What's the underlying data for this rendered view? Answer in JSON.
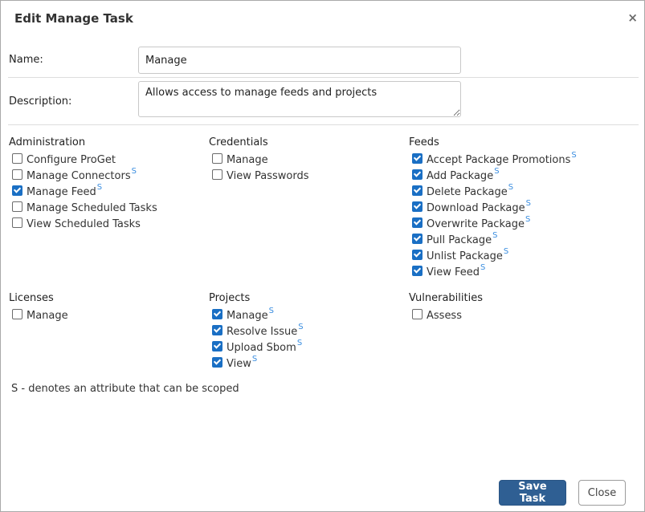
{
  "dialog": {
    "title": "Edit Manage Task",
    "close_icon": "×"
  },
  "form": {
    "name_label": "Name:",
    "name_value": "Manage",
    "description_label": "Description:",
    "description_value": "Allows access to manage feeds and projects"
  },
  "groups": [
    {
      "title": "Administration",
      "items": [
        {
          "label": "Configure ProGet",
          "checked": false,
          "scoped": false
        },
        {
          "label": "Manage Connectors",
          "checked": false,
          "scoped": true
        },
        {
          "label": "Manage Feed",
          "checked": true,
          "scoped": true
        },
        {
          "label": "Manage Scheduled Tasks",
          "checked": false,
          "scoped": false
        },
        {
          "label": "View Scheduled Tasks",
          "checked": false,
          "scoped": false
        }
      ]
    },
    {
      "title": "Credentials",
      "items": [
        {
          "label": "Manage",
          "checked": false,
          "scoped": false
        },
        {
          "label": "View Passwords",
          "checked": false,
          "scoped": false
        }
      ]
    },
    {
      "title": "Feeds",
      "items": [
        {
          "label": "Accept Package Promotions",
          "checked": true,
          "scoped": true
        },
        {
          "label": "Add Package",
          "checked": true,
          "scoped": true
        },
        {
          "label": "Delete Package",
          "checked": true,
          "scoped": true
        },
        {
          "label": "Download Package",
          "checked": true,
          "scoped": true
        },
        {
          "label": "Overwrite Package",
          "checked": true,
          "scoped": true
        },
        {
          "label": "Pull Package",
          "checked": true,
          "scoped": true
        },
        {
          "label": "Unlist Package",
          "checked": true,
          "scoped": true
        },
        {
          "label": "View Feed",
          "checked": true,
          "scoped": true
        }
      ]
    },
    {
      "title": "Licenses",
      "items": [
        {
          "label": "Manage",
          "checked": false,
          "scoped": false
        }
      ]
    },
    {
      "title": "Projects",
      "items": [
        {
          "label": "Manage",
          "checked": true,
          "scoped": true
        },
        {
          "label": "Resolve Issue",
          "checked": true,
          "scoped": true
        },
        {
          "label": "Upload Sbom",
          "checked": true,
          "scoped": true
        },
        {
          "label": "View",
          "checked": true,
          "scoped": true
        }
      ]
    },
    {
      "title": "Vulnerabilities",
      "items": [
        {
          "label": "Assess",
          "checked": false,
          "scoped": false
        }
      ]
    }
  ],
  "scope_marker": "S",
  "legend": "S - denotes an attribute that can be scoped",
  "buttons": {
    "save": "Save Task",
    "close": "Close"
  },
  "colors": {
    "checkbox_checked": "#1a6fc4",
    "scope_marker": "#3b8ee0",
    "save_button": "#2f5f93"
  }
}
